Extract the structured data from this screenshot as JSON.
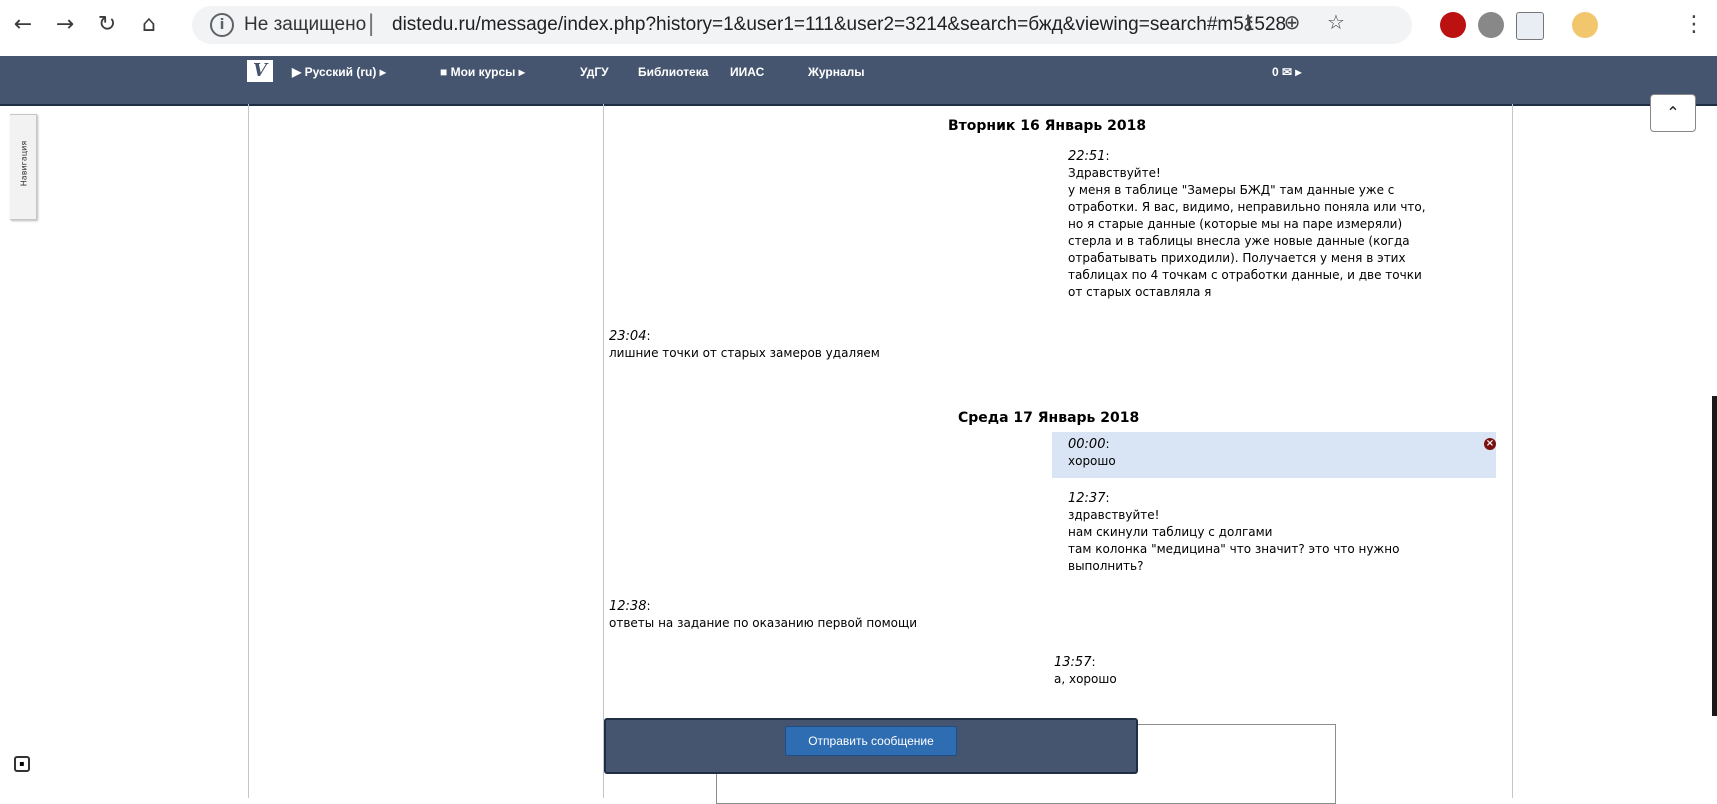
{
  "browser": {
    "security_label": "Не защищено",
    "separator": "|",
    "url": "distedu.ru/message/index.php?history=1&user1=111&user2=3214&search=бжд&viewing=search#m51528"
  },
  "nav": {
    "logo": "V",
    "language": "▶ Русский (ru) ▸",
    "my_courses": "■ Мои курсы ▸",
    "udgu": "УдГУ",
    "library": "Библиотека",
    "iias": "ИИАС",
    "journals": "Журналы",
    "messages": "0 ✉ ▸"
  },
  "sidebar": {
    "tab_label": "Навигация"
  },
  "conversation": {
    "day1": "Вторник 16 Январь 2018",
    "day2": "Среда 17 Январь 2018",
    "m1": {
      "time": "22:51",
      "lines": [
        "Здравствуйте!",
        "у меня в таблице \"Замеры БЖД\" там данные уже с",
        "отработки. Я вас, видимо, неправильно поняла или что,",
        "но я старые данные (которые мы на паре измеряли)",
        "стерла и в таблицы внесла уже новые данные (когда",
        "отрабатывать приходили). Получается у меня в этих",
        "таблицах по 4 точкам с отработки данные, и две точки",
        "от старых оставляла я"
      ]
    },
    "m2": {
      "time": "23:04",
      "lines": [
        "лишние точки от старых замеров удаляем"
      ]
    },
    "m3": {
      "time": "00:00",
      "lines": [
        "хорошо"
      ]
    },
    "m4": {
      "time": "12:37",
      "lines": [
        "здравствуйте!",
        "нам скинули таблицу с долгами",
        "там колонка \"медицина\" что значит? это что нужно",
        "выполнить?"
      ]
    },
    "m5": {
      "time": "12:38",
      "lines": [
        "ответы на задание по оказанию первой помощи"
      ]
    },
    "m6": {
      "time": "13:57",
      "lines": [
        "а, хорошо"
      ]
    }
  },
  "composer": {
    "send_label": "Отправить сообщение"
  }
}
